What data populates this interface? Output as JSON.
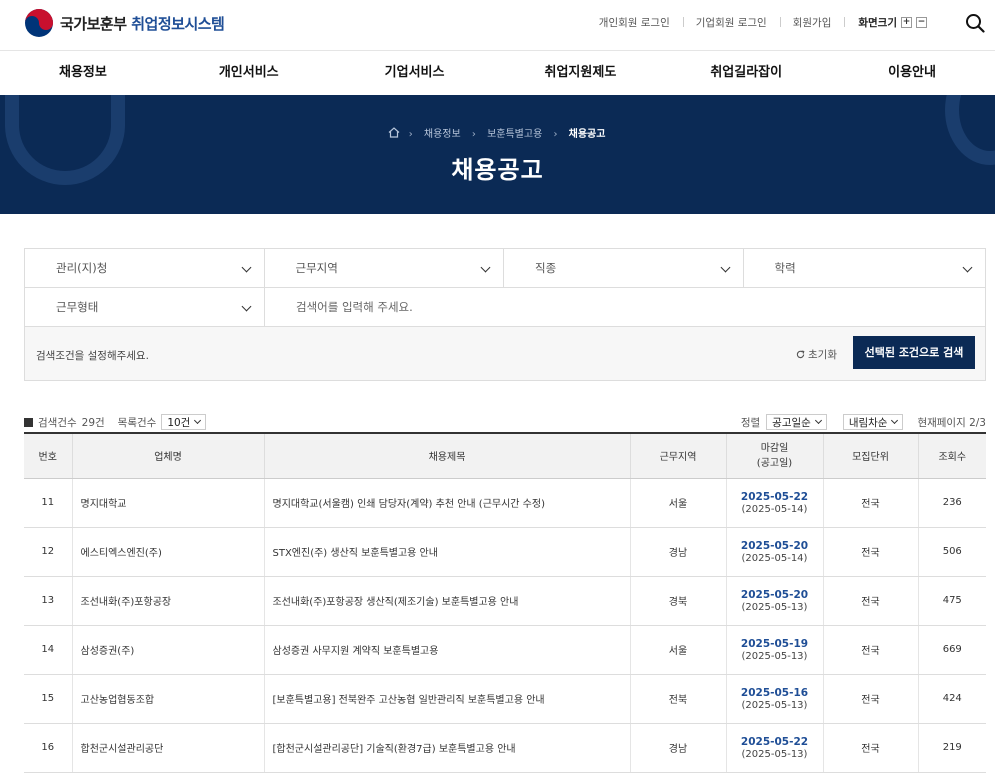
{
  "header": {
    "org_name": "국가보훈부",
    "system_name": "취업정보시스템",
    "util_links": [
      "개인회원 로그인",
      "기업회원 로그인",
      "회원가입"
    ],
    "zoom_label": "화면크기",
    "zoom_in": "+",
    "zoom_out": "−",
    "emblem_colors": {
      "red": "#c8102e",
      "blue": "#003478"
    }
  },
  "gnb": [
    "채용정보",
    "개인서비스",
    "기업서비스",
    "취업지원제도",
    "취업길라잡이",
    "이용안내"
  ],
  "hero": {
    "breadcrumb": [
      "채용정보",
      "보훈특별고용",
      "채용공고"
    ],
    "title": "채용공고",
    "bg_color": "#0b2a55"
  },
  "search": {
    "filters": [
      "관리(지)청",
      "근무지역",
      "직종",
      "학력",
      "근무형태"
    ],
    "keyword_placeholder": "검색어를 입력해 주세요.",
    "hint": "검색조건을 설정해주세요.",
    "reset_label": "초기화",
    "submit_label": "선택된 조건으로 검색"
  },
  "list_meta": {
    "total_label": "검색건수",
    "total_value": "29건",
    "per_page_label": "목록건수",
    "per_page_value": "10건",
    "sort_label": "정렬",
    "sort_value": "공고일순",
    "order_value": "내림차순",
    "page_label": "현재페이지 2/3"
  },
  "table": {
    "headers": [
      "번호",
      "업체명",
      "채용제목",
      "근무지역",
      "마감일\n(공고일)",
      "모집단위",
      "조회수"
    ],
    "rows": [
      {
        "no": "11",
        "company": "명지대학교",
        "title": "명지대학교(서울캠) 인쇄 담당자(계약) 추천 안내 (근무시간 수정)",
        "region": "서울",
        "deadline": "2025-05-22",
        "posted": "(2025-05-14)",
        "unit": "전국",
        "views": "236"
      },
      {
        "no": "12",
        "company": "에스티엑스엔진(주)",
        "title": "STX엔진(주) 생산직 보훈특별고용 안내",
        "region": "경남",
        "deadline": "2025-05-20",
        "posted": "(2025-05-14)",
        "unit": "전국",
        "views": "506"
      },
      {
        "no": "13",
        "company": "조선내화(주)포항공장",
        "title": "조선내화(주)포항공장 생산직(제조기술) 보훈특별고용 안내",
        "region": "경북",
        "deadline": "2025-05-20",
        "posted": "(2025-05-13)",
        "unit": "전국",
        "views": "475"
      },
      {
        "no": "14",
        "company": "삼성증권(주)",
        "title": "삼성증권 사무지원 계약직 보훈특별고용",
        "region": "서울",
        "deadline": "2025-05-19",
        "posted": "(2025-05-13)",
        "unit": "전국",
        "views": "669"
      },
      {
        "no": "15",
        "company": "고산농업협동조합",
        "title": "[보훈특별고용] 전북완주 고산농협 일반관리직 보훈특별고용 안내",
        "region": "전북",
        "deadline": "2025-05-16",
        "posted": "(2025-05-13)",
        "unit": "전국",
        "views": "424"
      },
      {
        "no": "16",
        "company": "합천군시설관리공단",
        "title": "[합천군시설관리공단] 기술직(환경7급) 보훈특별고용 안내",
        "region": "경남",
        "deadline": "2025-05-22",
        "posted": "(2025-05-13)",
        "unit": "전국",
        "views": "219"
      }
    ]
  }
}
